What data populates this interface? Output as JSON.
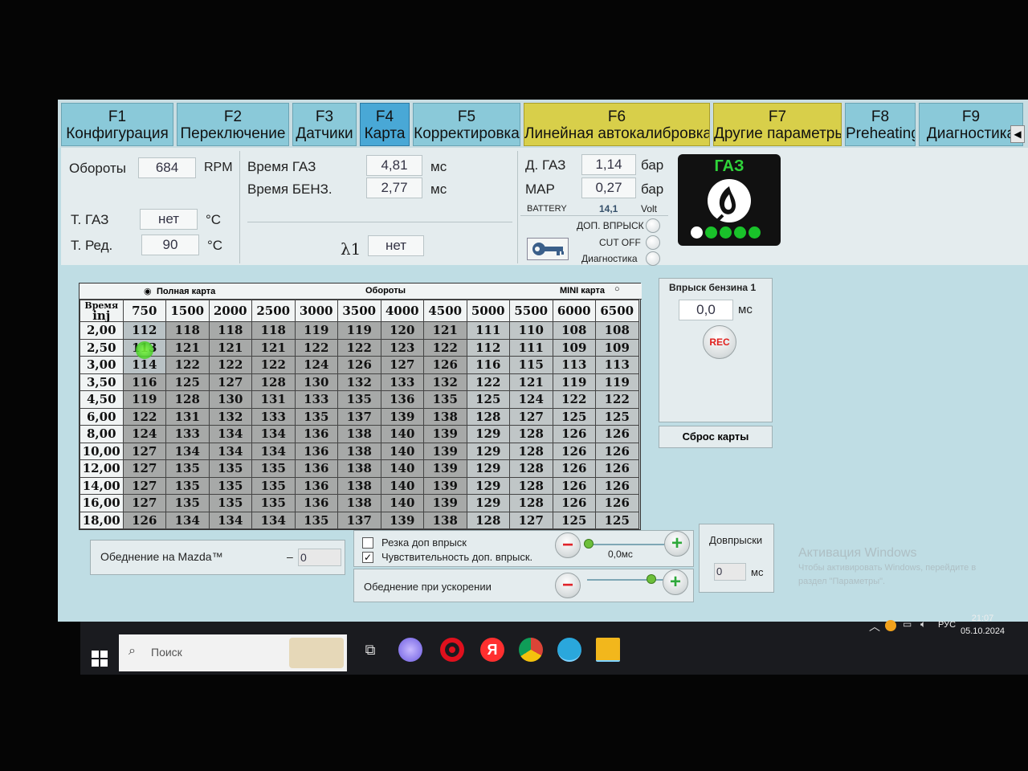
{
  "tabs": [
    {
      "key": "F1",
      "label": "Конфигурация"
    },
    {
      "key": "F2",
      "label": "Переключение"
    },
    {
      "key": "F3",
      "label": "Датчики"
    },
    {
      "key": "F4",
      "label": "Карта"
    },
    {
      "key": "F5",
      "label": "Корректировка"
    },
    {
      "key": "F6",
      "label": "Линейная автокалибровка"
    },
    {
      "key": "F7",
      "label": "Другие параметры"
    },
    {
      "key": "F8",
      "label": "Preheating"
    },
    {
      "key": "F9",
      "label": "Диагностика"
    }
  ],
  "info": {
    "rpm_label": "Обороты",
    "rpm_value": "684",
    "rpm_unit": "RPM",
    "t_gas_label": "Т. ГАЗ",
    "t_gas_value": "нет",
    "t_gas_unit": "°C",
    "t_red_label": "Т. Ред.",
    "t_red_value": "90",
    "t_red_unit": "°C",
    "time_gas_label": "Время ГАЗ",
    "time_gas_value": "4,81",
    "time_gas_unit": "мс",
    "time_benz_label": "Время БЕНЗ.",
    "time_benz_value": "2,77",
    "time_benz_unit": "мс",
    "lambda_label": "λ1",
    "lambda_value": "нет",
    "d_gas_label": "Д. ГАЗ",
    "d_gas_value": "1,14",
    "d_gas_unit": "бар",
    "map_label": "MAP",
    "map_value": "0,27",
    "map_unit": "бар",
    "battery_label": "BATTERY",
    "battery_value": "14,1",
    "battery_unit": "Volt",
    "dop_vprysk": "ДОП. ВПРЫСК",
    "cut_off": "CUT OFF",
    "diagnostika": "Диагностика",
    "gas_status": "ГАЗ"
  },
  "map": {
    "full_map_label": "Полная карта",
    "rpm_header": "Обороты",
    "mini_map_label": "MINI карта",
    "corner_top": "Время",
    "corner_bottom": "inj",
    "columns": [
      "750",
      "1500",
      "2000",
      "2500",
      "3000",
      "3500",
      "4000",
      "4500",
      "5000",
      "5500",
      "6000",
      "6500"
    ],
    "rows": [
      {
        "inj": "2,00",
        "values": [
          "112",
          "118",
          "118",
          "118",
          "119",
          "119",
          "120",
          "121",
          "111",
          "110",
          "108",
          "108"
        ]
      },
      {
        "inj": "2,50",
        "values": [
          "113",
          "121",
          "121",
          "121",
          "122",
          "122",
          "123",
          "122",
          "112",
          "111",
          "109",
          "109"
        ]
      },
      {
        "inj": "3,00",
        "values": [
          "114",
          "122",
          "122",
          "122",
          "124",
          "126",
          "127",
          "126",
          "116",
          "115",
          "113",
          "113"
        ]
      },
      {
        "inj": "3,50",
        "values": [
          "116",
          "125",
          "127",
          "128",
          "130",
          "132",
          "133",
          "132",
          "122",
          "121",
          "119",
          "119"
        ]
      },
      {
        "inj": "4,50",
        "values": [
          "119",
          "128",
          "130",
          "131",
          "133",
          "135",
          "136",
          "135",
          "125",
          "124",
          "122",
          "122"
        ]
      },
      {
        "inj": "6,00",
        "values": [
          "122",
          "131",
          "132",
          "133",
          "135",
          "137",
          "139",
          "138",
          "128",
          "127",
          "125",
          "125"
        ]
      },
      {
        "inj": "8,00",
        "values": [
          "124",
          "133",
          "134",
          "134",
          "136",
          "138",
          "140",
          "139",
          "129",
          "128",
          "126",
          "126"
        ]
      },
      {
        "inj": "10,00",
        "values": [
          "127",
          "134",
          "134",
          "134",
          "136",
          "138",
          "140",
          "139",
          "129",
          "128",
          "126",
          "126"
        ]
      },
      {
        "inj": "12,00",
        "values": [
          "127",
          "135",
          "135",
          "135",
          "136",
          "138",
          "140",
          "139",
          "129",
          "128",
          "126",
          "126"
        ]
      },
      {
        "inj": "14,00",
        "values": [
          "127",
          "135",
          "135",
          "135",
          "136",
          "138",
          "140",
          "139",
          "129",
          "128",
          "126",
          "126"
        ]
      },
      {
        "inj": "16,00",
        "values": [
          "127",
          "135",
          "135",
          "135",
          "136",
          "138",
          "140",
          "139",
          "129",
          "128",
          "126",
          "126"
        ]
      },
      {
        "inj": "18,00",
        "values": [
          "126",
          "134",
          "134",
          "134",
          "135",
          "137",
          "139",
          "138",
          "128",
          "127",
          "125",
          "125"
        ]
      }
    ]
  },
  "petrol": {
    "title": "Впрыск бензина 1",
    "value": "0,0",
    "unit": "мс",
    "rec_label": "REC",
    "reset_label": "Сброс карты"
  },
  "controls": {
    "mazda_label": "Обеднение на Mazda™",
    "mazda_dash": "–",
    "mazda_value": "0",
    "rezka_label": "Резка доп впрыск",
    "sens_label": "Чувствительность доп. впрыск.",
    "sens_value": "0,0мс",
    "sens_slider_level": 0.0,
    "accel_label": "Обеднение при ускорении",
    "accel_slider_level": 1.0,
    "dovpryski_label": "Довпрыски",
    "dovpryski_value": "0",
    "dovpryski_unit": "мс"
  },
  "watermark": {
    "title": "Активация Windows",
    "line1": "Чтобы активировать Windows, перейдите в",
    "line2": "раздел \"Параметры\"."
  },
  "taskbar": {
    "search_placeholder": "Поиск",
    "lang": "РУС",
    "time": "21:07",
    "date": "05.10.2024"
  }
}
